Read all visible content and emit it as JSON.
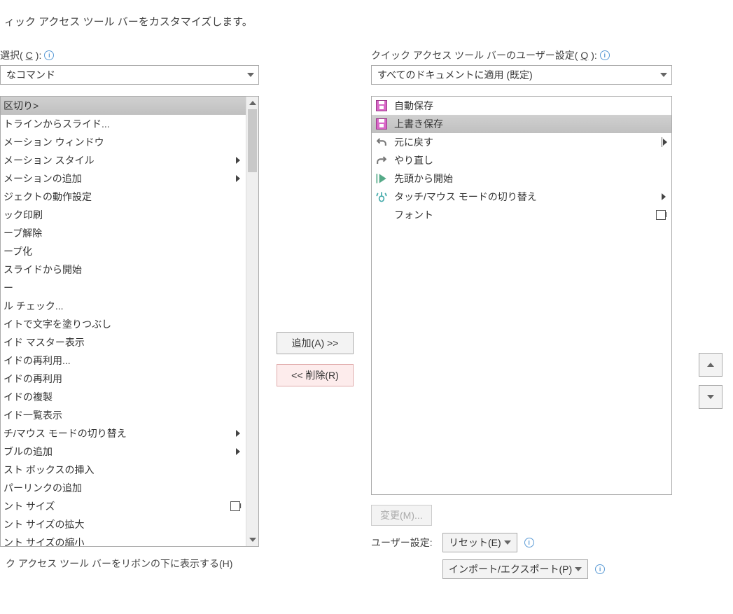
{
  "title": "ィック アクセス ツール バーをカスタマイズします。",
  "left": {
    "choose_label_pre": "選択(",
    "choose_label_key": "C",
    "choose_label_post": "):",
    "combo_value": "なコマンド",
    "items": [
      {
        "text": "区切り>",
        "selected": true
      },
      {
        "text": "トラインからスライド..."
      },
      {
        "text": "メーション ウィンドウ"
      },
      {
        "text": "メーション スタイル",
        "submenu": true
      },
      {
        "text": "メーションの追加",
        "submenu": true
      },
      {
        "text": "ジェクトの動作設定"
      },
      {
        "text": "ック印刷"
      },
      {
        "text": "ープ解除"
      },
      {
        "text": "ープ化"
      },
      {
        "text": "スライドから開始"
      },
      {
        "text": "ー"
      },
      {
        "text": "ル チェック..."
      },
      {
        "text": "イトで文字を塗りつぶし"
      },
      {
        "text": "イド マスター表示"
      },
      {
        "text": "イドの再利用..."
      },
      {
        "text": "イドの再利用"
      },
      {
        "text": "イドの複製"
      },
      {
        "text": "イド一覧表示"
      },
      {
        "text": "チ/マウス モードの切り替え",
        "submenu": true
      },
      {
        "text": "ブルの追加",
        "submenu": true
      },
      {
        "text": "スト ボックスの挿入"
      },
      {
        "text": "パーリンクの追加"
      },
      {
        "text": "ント サイズ",
        "fontbox": true
      },
      {
        "text": "ント サイズの拡大"
      },
      {
        "text": "ント サイズの縮小"
      }
    ]
  },
  "mid": {
    "add_label": "追加(A) >>",
    "remove_label": "<< 削除(R)"
  },
  "right": {
    "qat_label_pre": "クイック アクセス ツール バーのユーザー設定(",
    "qat_label_key": "Q",
    "qat_label_post": "):",
    "combo_value": "すべてのドキュメントに適用 (既定)",
    "items": [
      {
        "icon": "disk",
        "text": "自動保存"
      },
      {
        "icon": "disk",
        "text": "上書き保存",
        "selected": true
      },
      {
        "icon": "undo",
        "text": "元に戻す",
        "sep": true
      },
      {
        "icon": "redo",
        "text": "やり直し"
      },
      {
        "icon": "play",
        "text": "先頭から開始"
      },
      {
        "icon": "touch",
        "text": "タッチ/マウス モードの切り替え",
        "submenu": true
      },
      {
        "icon": "",
        "text": "フォント",
        "fontbox": true
      }
    ],
    "modify_label": "変更(M)...",
    "user_settings_label": "ユーザー設定:",
    "reset_label": "リセット(E)",
    "import_export_label": "インポート/エクスポート(P)"
  },
  "bottom": {
    "show_below_label": "ク アクセス ツール バーをリボンの下に表示する(H)"
  }
}
